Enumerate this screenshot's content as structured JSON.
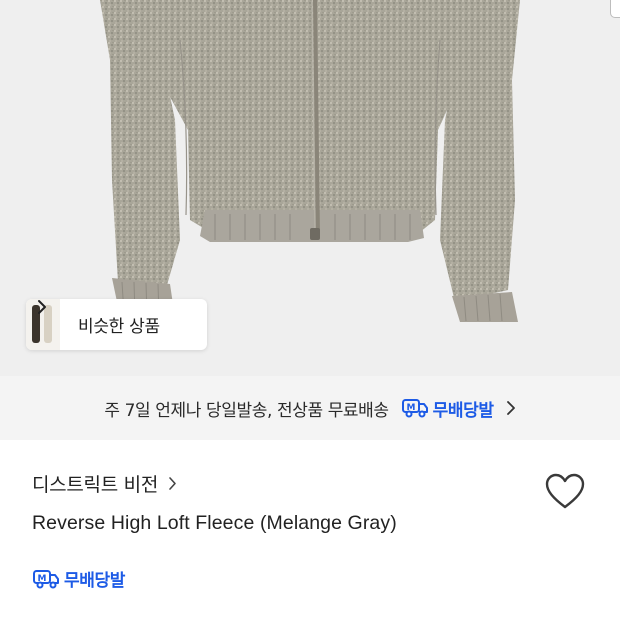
{
  "hero": {
    "similar_button": {
      "label": "비슷한 상품",
      "icon": "chevron-right-icon"
    }
  },
  "shipping_banner": {
    "text": "주 7일 언제나 당일발송, 전상품 무료배송",
    "badge_label": "무배당발",
    "badge_icon": "delivery-truck-icon",
    "icon": "chevron-right-icon"
  },
  "product": {
    "brand": "디스트릭트 비전",
    "title": "Reverse High Loft Fleece (Melange Gray)",
    "wish_icon": "heart-outline-icon",
    "free_ship_badge": "무배당발"
  },
  "colors": {
    "accent_blue": "#1d5be6",
    "banner_bg": "#f4f4f4",
    "photo_bg": "#efefef"
  }
}
